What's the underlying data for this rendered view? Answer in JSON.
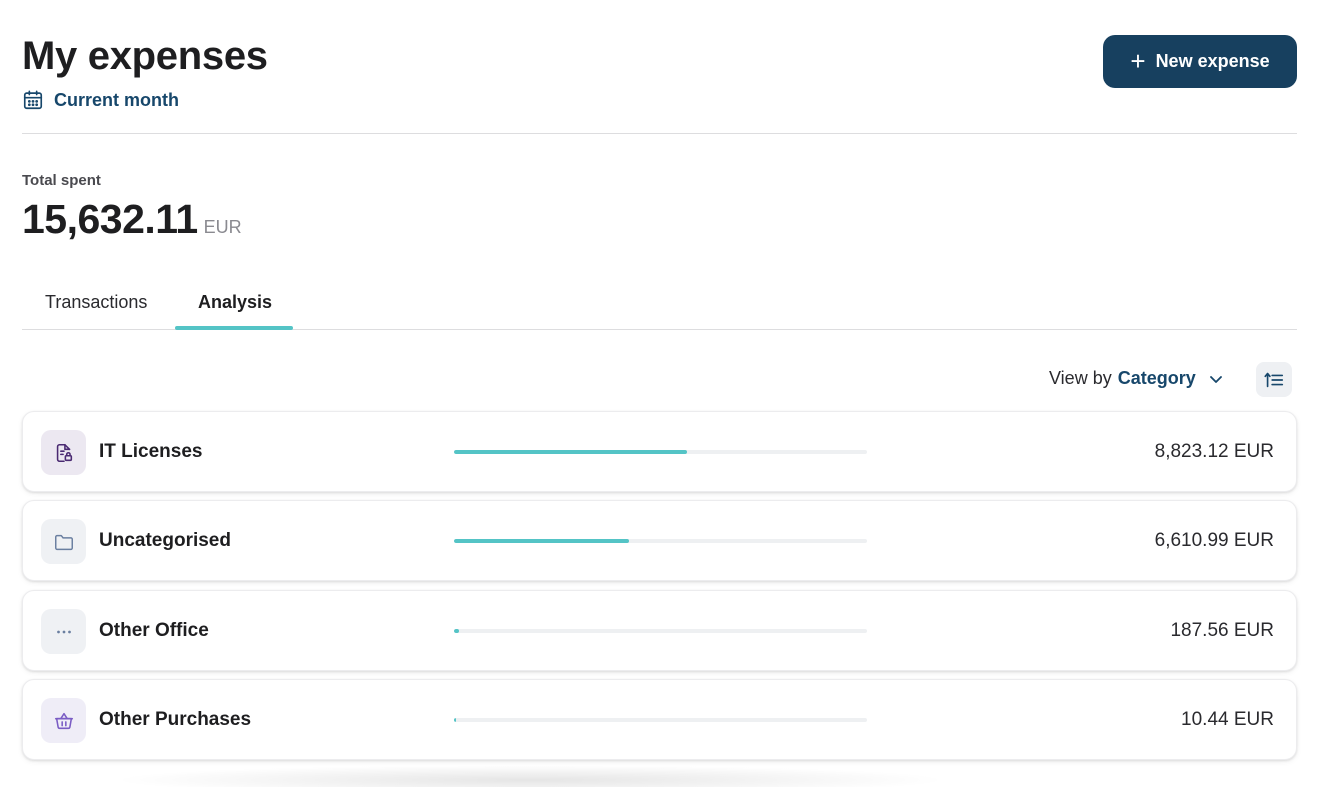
{
  "header": {
    "title": "My expenses",
    "period_label": "Current month",
    "new_expense_label": "New expense"
  },
  "total": {
    "label": "Total spent",
    "amount": "15,632.11",
    "currency": "EUR"
  },
  "tabs": [
    {
      "label": "Transactions",
      "active": false
    },
    {
      "label": "Analysis",
      "active": true
    }
  ],
  "view_by": {
    "prefix": "View by",
    "value": "Category"
  },
  "categories": [
    {
      "name": "IT Licenses",
      "amount": "8,823.12 EUR",
      "share": 0.5644,
      "icon": "license-document-icon"
    },
    {
      "name": "Uncategorised",
      "amount": "6,610.99 EUR",
      "share": 0.4229,
      "icon": "folder-icon"
    },
    {
      "name": "Other Office",
      "amount": "187.56 EUR",
      "share": 0.012,
      "icon": "more-dots-icon"
    },
    {
      "name": "Other Purchases",
      "amount": "10.44 EUR",
      "share": 0.0007,
      "icon": "shopping-basket-icon"
    }
  ],
  "colors": {
    "primary": "#17405f",
    "link": "#17476b",
    "accent": "#54c4c6",
    "icon_purple": "#6b3fa0",
    "icon_slate": "#6a7fa0"
  }
}
